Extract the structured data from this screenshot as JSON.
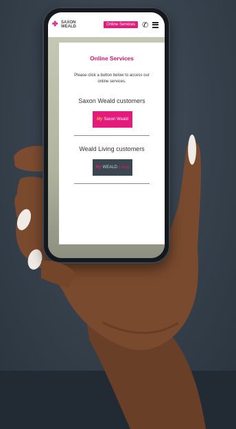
{
  "header": {
    "logo_line1": "SAXON",
    "logo_line2": "WEALD",
    "online_services_button": "Online Services"
  },
  "modal": {
    "title": "Online Services",
    "description": "Please click a button below to access our online services.",
    "saxon_heading": "Saxon Weald customers",
    "saxon_button": {
      "prefix": "My",
      "label": "Saxon Weald"
    },
    "weald_heading": "Weald Living customers",
    "weald_button": {
      "prefix": "My",
      "label": "WEALD",
      "suffix": "Living"
    }
  },
  "footer_text": "",
  "colors": {
    "brand_pink": "#e6197d",
    "weald_dark": "#3a4650",
    "background": "#36414c"
  }
}
